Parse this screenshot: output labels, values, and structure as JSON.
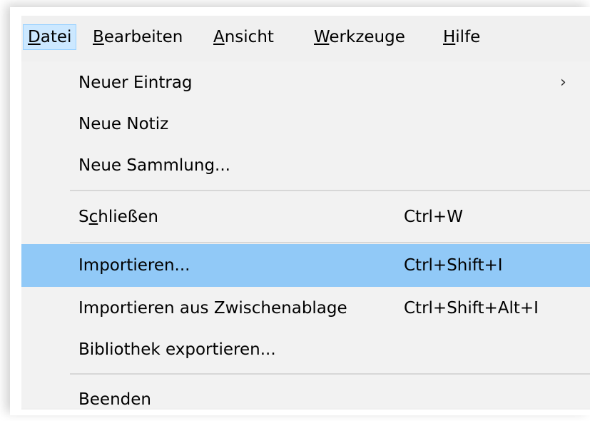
{
  "menubar": {
    "items": [
      {
        "prefix": "",
        "accel": "D",
        "suffix": "atei",
        "active": true
      },
      {
        "prefix": "",
        "accel": "B",
        "suffix": "earbeiten",
        "active": false
      },
      {
        "prefix": "",
        "accel": "A",
        "suffix": "nsicht",
        "active": false
      },
      {
        "prefix": "",
        "accel": "W",
        "suffix": "erkzeuge",
        "active": false
      },
      {
        "prefix": "",
        "accel": "H",
        "suffix": "ilfe",
        "active": false
      }
    ]
  },
  "file_menu": {
    "items": [
      {
        "label": "Neuer Eintrag",
        "shortcut": "",
        "submenu_arrow": "›"
      },
      {
        "label": "Neue Notiz",
        "shortcut": ""
      },
      {
        "label": "Neue Sammlung...",
        "shortcut": ""
      },
      {
        "label_prefix": "S",
        "label_accel": "c",
        "label_suffix": "hließen",
        "shortcut": "Ctrl+W"
      },
      {
        "label": "Importieren...",
        "shortcut": "Ctrl+Shift+I",
        "highlighted": true
      },
      {
        "label": "Importieren aus Zwischenablage",
        "shortcut": "Ctrl+Shift+Alt+I"
      },
      {
        "label": "Bibliothek exportieren...",
        "shortcut": ""
      },
      {
        "label": "Beenden",
        "shortcut": ""
      }
    ]
  },
  "colors": {
    "menu_background": "#f2f2f2",
    "highlight": "#91c9f7",
    "active_menubar": "#cce8ff",
    "separator": "#d7d7d7"
  }
}
